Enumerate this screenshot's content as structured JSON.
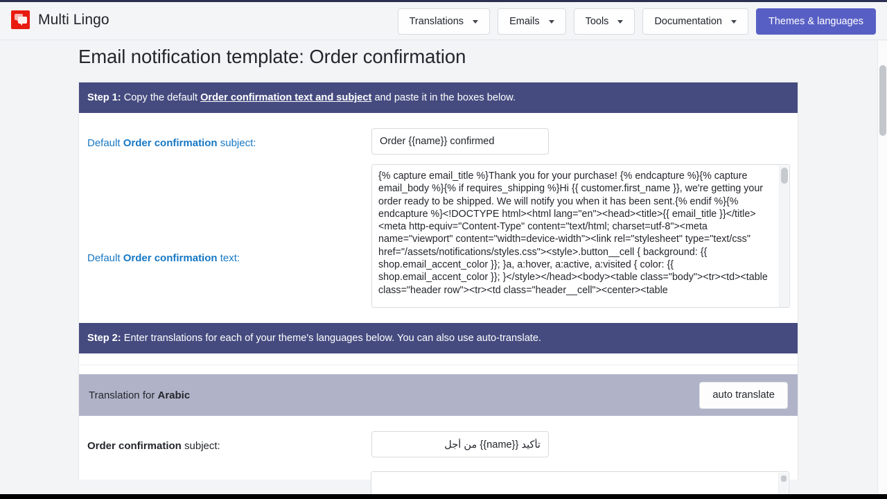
{
  "header": {
    "brand_name": "Multi Lingo",
    "logo_icon": "chat-bubbles-icon",
    "nav": [
      {
        "label": "Translations",
        "has_caret": true,
        "primary": false
      },
      {
        "label": "Emails",
        "has_caret": true,
        "primary": false
      },
      {
        "label": "Tools",
        "has_caret": true,
        "primary": false
      },
      {
        "label": "Documentation",
        "has_caret": true,
        "primary": false
      },
      {
        "label": "Themes & languages",
        "has_caret": false,
        "primary": true
      }
    ]
  },
  "page": {
    "title": "Email notification template: Order confirmation"
  },
  "step1": {
    "prefix": "Step 1:",
    "text_before": " Copy the default ",
    "link": "Order confirmation text and subject",
    "text_after": " and paste it in the boxes below."
  },
  "default_subject": {
    "label_prefix": "Default ",
    "label_strong": "Order confirmation",
    "label_suffix": " subject:",
    "value": "Order {{name}} confirmed"
  },
  "default_text": {
    "label_prefix": "Default ",
    "label_strong": "Order confirmation",
    "label_suffix": " text:",
    "value": "{% capture email_title %}Thank you for your purchase! {% endcapture %}{% capture email_body %}{% if requires_shipping %}Hi {{ customer.first_name }}, we're getting your order ready to be shipped. We will notify you when it has been sent.{% endif %}{% endcapture %}<!DOCTYPE html><html lang=\"en\"><head><title>{{ email_title }}</title><meta http-equiv=\"Content-Type\" content=\"text/html; charset=utf-8\"><meta name=\"viewport\" content=\"width=device-width\"><link rel=\"stylesheet\" type=\"text/css\" href=\"/assets/notifications/styles.css\"><style>.button__cell { background: {{ shop.email_accent_color }}; }a, a:hover, a:active, a:visited { color: {{ shop.email_accent_color }}; }</style></head><body><table class=\"body\"><tr><td><table class=\"header row\"><tr><td class=\"header__cell\"><center><table"
  },
  "step2": {
    "prefix": "Step 2:",
    "text": " Enter translations for each of your theme's languages below. You can also use auto-translate."
  },
  "translation": {
    "label_prefix": "Translation for ",
    "language": "Arabic",
    "auto_translate_label": "auto translate",
    "subject": {
      "label_strong": "Order confirmation",
      "label_suffix": " subject:",
      "value": "تأكيد {{name}} من أجل"
    }
  },
  "colors": {
    "accent_primary": "#585fc4",
    "step_bar": "#454b7f",
    "translation_bar": "#b0b3c8",
    "link_blue": "#1778c4",
    "logo_red": "#e81b11",
    "page_bg": "#f3f4f6"
  }
}
